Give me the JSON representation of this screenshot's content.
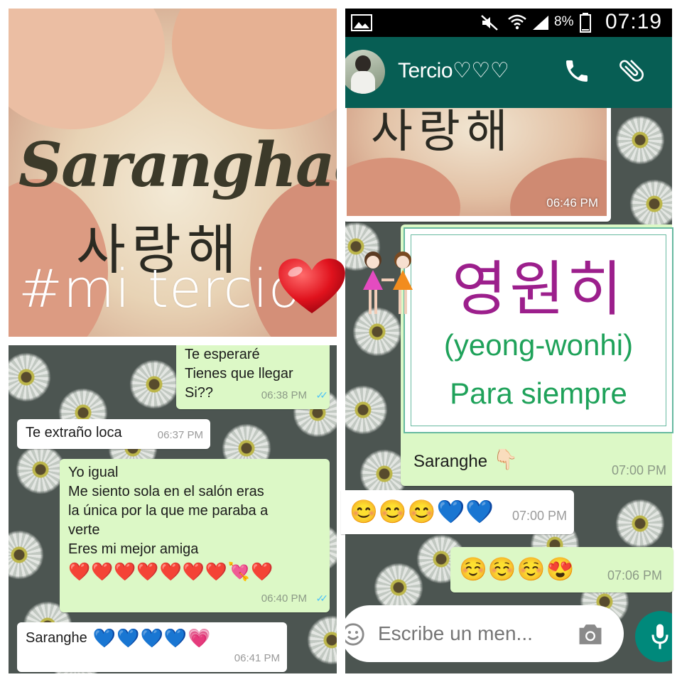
{
  "heart_image": {
    "title_latin": "Saranghae",
    "title_korean": "사랑해",
    "hashtag": "#mi tercio"
  },
  "left_chat": {
    "messages": [
      {
        "direction": "out",
        "lines": [
          "Te esperaré",
          "Tienes que llegar",
          "Si??"
        ],
        "time": "06:38 PM"
      },
      {
        "direction": "in",
        "lines": [
          "Te extraño loca"
        ],
        "time": "06:37 PM"
      },
      {
        "direction": "out",
        "lines": [
          "Yo igual",
          "Me siento sola en el salón  eras",
          "la única por la que me paraba a",
          "verte",
          "Eres mi mejor amiga"
        ],
        "emojis": "❤️❤️❤️❤️❤️❤️❤️💘❤️",
        "time": "06:40 PM"
      },
      {
        "direction": "in",
        "lines": [
          "Saranghe"
        ],
        "emojis": "💙💙💙💙💗",
        "time": "06:41 PM"
      }
    ]
  },
  "right_chat": {
    "status_bar": {
      "battery": "8%",
      "time": "07:19"
    },
    "contact_name": "Tercio♡♡♡",
    "image_time": "06:46 PM",
    "image_caption_korean": "사랑해",
    "card": {
      "korean": "영원히",
      "romanization": "(yeong-wonhi)",
      "translation": "Para siempre"
    },
    "card_caption": "Saranghe",
    "card_caption_emoji": "👇🏻",
    "card_time": "07:00 PM",
    "emoji_msg_in": "😊😊😊💙💙",
    "emoji_msg_in_time": "07:00 PM",
    "emoji_msg_out": "☺️☺️☺️😍",
    "emoji_msg_out_time": "07:06 PM",
    "input_placeholder": "Escribe un men..."
  },
  "colors": {
    "whatsapp_green": "#075e54",
    "bubble_out": "#dcf8c6",
    "bubble_in": "#ffffff",
    "korean_purple": "#9c1f8c",
    "card_green": "#1fa25a"
  },
  "icons": [
    "image-icon",
    "mute-icon",
    "wifi-icon",
    "signal-icon",
    "battery-icon",
    "phone-icon",
    "paperclip-icon",
    "emoji-icon",
    "camera-icon",
    "mic-icon",
    "double-check-icon"
  ]
}
